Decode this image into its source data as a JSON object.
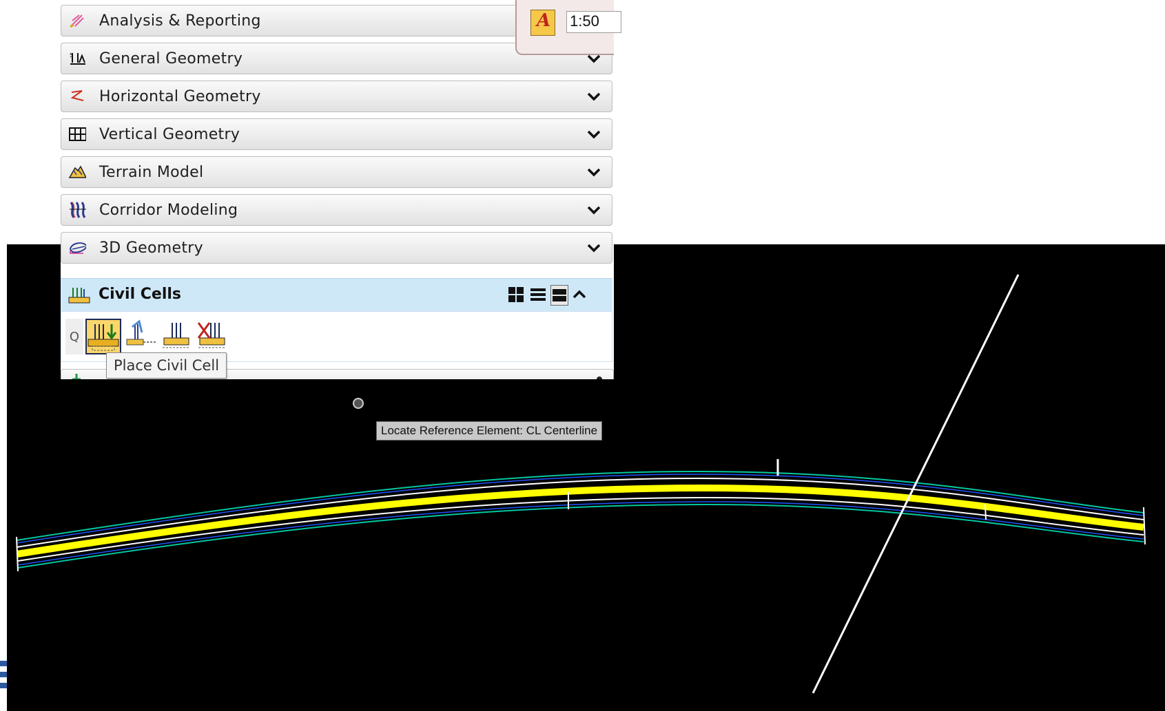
{
  "panel": {
    "groups": [
      {
        "label": "Analysis & Reporting",
        "icon": "analysis-reporting-icon"
      },
      {
        "label": "General Geometry",
        "icon": "general-geometry-icon"
      },
      {
        "label": "Horizontal Geometry",
        "icon": "horizontal-geometry-icon"
      },
      {
        "label": "Vertical Geometry",
        "icon": "vertical-geometry-icon"
      },
      {
        "label": "Terrain Model",
        "icon": "terrain-model-icon"
      },
      {
        "label": "Corridor Modeling",
        "icon": "corridor-modeling-icon"
      },
      {
        "label": "3D Geometry",
        "icon": "3d-geometry-icon"
      }
    ],
    "civil_cells": {
      "label": "Civil Cells",
      "search_tab": "Q",
      "tools": [
        "place-civil-cell-icon",
        "create-civil-cell-icon",
        "edit-civil-cell-icon",
        "delete-civil-cell-icon"
      ],
      "active_tool": "Place Civil Cell"
    }
  },
  "tooltip": {
    "text": "Place Civil Cell"
  },
  "scale": {
    "value": "1:50",
    "icon": "annotation-scale-icon"
  },
  "view": {
    "locate_prompt": "Locate Reference Element: CL Centerline",
    "colors": {
      "background": "#000000",
      "centerline": "#ffff00",
      "edge": "#00c8a0",
      "lane": "#ffffff",
      "crossline": "#ffffff"
    }
  }
}
